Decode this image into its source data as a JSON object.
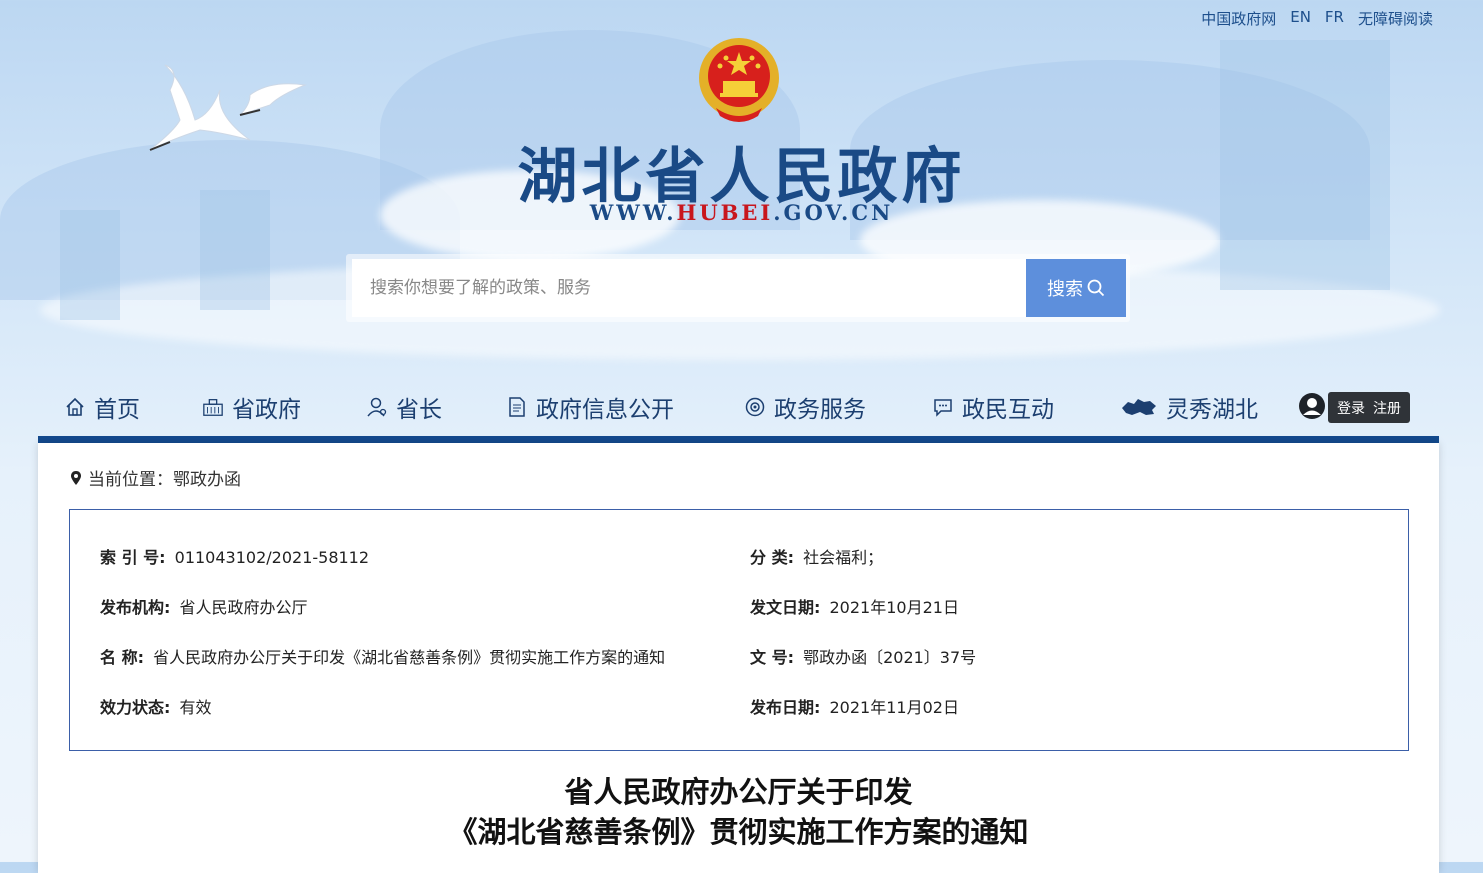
{
  "header": {
    "top_links": [
      "中国政府网",
      "EN",
      "FR",
      "无障碍阅读"
    ],
    "site_title": "湖北省人民政府",
    "site_url_prefix": "WWW.",
    "site_url_mid": "HUBEI",
    "site_url_suffix": ".GOV.CN"
  },
  "search": {
    "placeholder": "搜索你想要了解的政策、服务",
    "button_label": "搜索"
  },
  "nav": {
    "items": [
      {
        "label": "首页",
        "icon": "home-icon"
      },
      {
        "label": "省政府",
        "icon": "building-icon"
      },
      {
        "label": "省长",
        "icon": "person-icon"
      },
      {
        "label": "政府信息公开",
        "icon": "document-icon"
      },
      {
        "label": "政务服务",
        "icon": "service-icon"
      },
      {
        "label": "政民互动",
        "icon": "chat-icon"
      },
      {
        "label": "灵秀湖北",
        "icon": "hubei-map-icon"
      }
    ],
    "login_label": "登录",
    "register_label": "注册",
    "bar_color": "#134a8e"
  },
  "content": {
    "breadcrumb_label": "当前位置：",
    "breadcrumb_value": "鄂政办函",
    "info": {
      "index_label": "索 引 号:",
      "index_value": "011043102/2021-58112",
      "category_label": "分  类:",
      "category_value": "社会福利；",
      "publisher_label": "发布机构:",
      "publisher_value": "省人民政府办公厅",
      "issue_date_label": "发文日期:",
      "issue_date_value": "2021年10月21日",
      "name_label": "名  称:",
      "name_value": "省人民政府办公厅关于印发《湖北省慈善条例》贯彻实施工作方案的通知",
      "doc_no_label": "文  号:",
      "doc_no_value": "鄂政办函〔2021〕37号",
      "status_label": "效力状态:",
      "status_value": "有效",
      "publish_date_label": "发布日期:",
      "publish_date_value": "2021年11月02日"
    },
    "title_line1": "省人民政府办公厅关于印发",
    "title_line2": "《湖北省慈善条例》贯彻实施工作方案的通知"
  }
}
